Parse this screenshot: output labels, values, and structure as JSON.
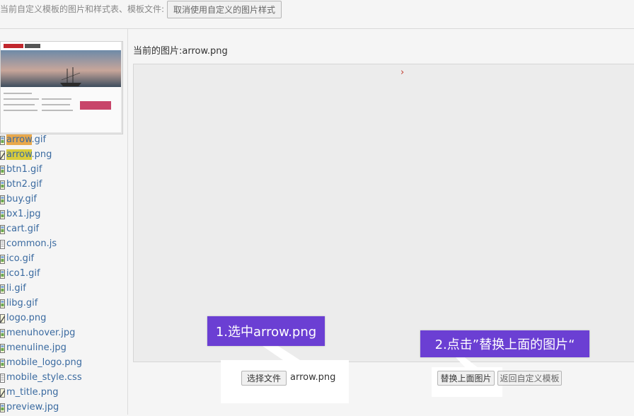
{
  "header": {
    "description": "当前自定义模板的图片和样式表、模板文件:",
    "cancel_button": "取消使用自定义的图片样式"
  },
  "sidebar": {
    "files": [
      {
        "name": "arrow.gif",
        "type": "image",
        "highlight": "orange"
      },
      {
        "name": "arrow.png",
        "type": "image-edit",
        "highlight": "yellow"
      },
      {
        "name": "btn1.gif",
        "type": "image"
      },
      {
        "name": "btn2.gif",
        "type": "image"
      },
      {
        "name": "buy.gif",
        "type": "image"
      },
      {
        "name": "bx1.jpg",
        "type": "image"
      },
      {
        "name": "cart.gif",
        "type": "image"
      },
      {
        "name": "common.js",
        "type": "script"
      },
      {
        "name": "ico.gif",
        "type": "image"
      },
      {
        "name": "ico1.gif",
        "type": "image"
      },
      {
        "name": "li.gif",
        "type": "image"
      },
      {
        "name": "libg.gif",
        "type": "image"
      },
      {
        "name": "logo.png",
        "type": "image-edit"
      },
      {
        "name": "menuhover.jpg",
        "type": "image"
      },
      {
        "name": "menuline.jpg",
        "type": "image"
      },
      {
        "name": "mobile_logo.png",
        "type": "image"
      },
      {
        "name": "mobile_style.css",
        "type": "script"
      },
      {
        "name": "m_title.png",
        "type": "image-edit"
      },
      {
        "name": "preview.jpg",
        "type": "image"
      }
    ]
  },
  "main": {
    "current_image_label": "当前的图片:arrow.png",
    "preview_glyph": "›",
    "choose_file_button": "选择文件",
    "chosen_filename": "arrow.png",
    "replace_button": "替换上面图片",
    "back_button": "返回自定义模板"
  },
  "callouts": {
    "step1": "1.选中arrow.png",
    "step2": "2.点击”替换上面的图片“"
  },
  "colors": {
    "callout_bg": "#6b3fd3",
    "link": "#3a6aa0",
    "highlight_orange": "#e8a84c",
    "highlight_yellow": "#d9cc3c"
  }
}
